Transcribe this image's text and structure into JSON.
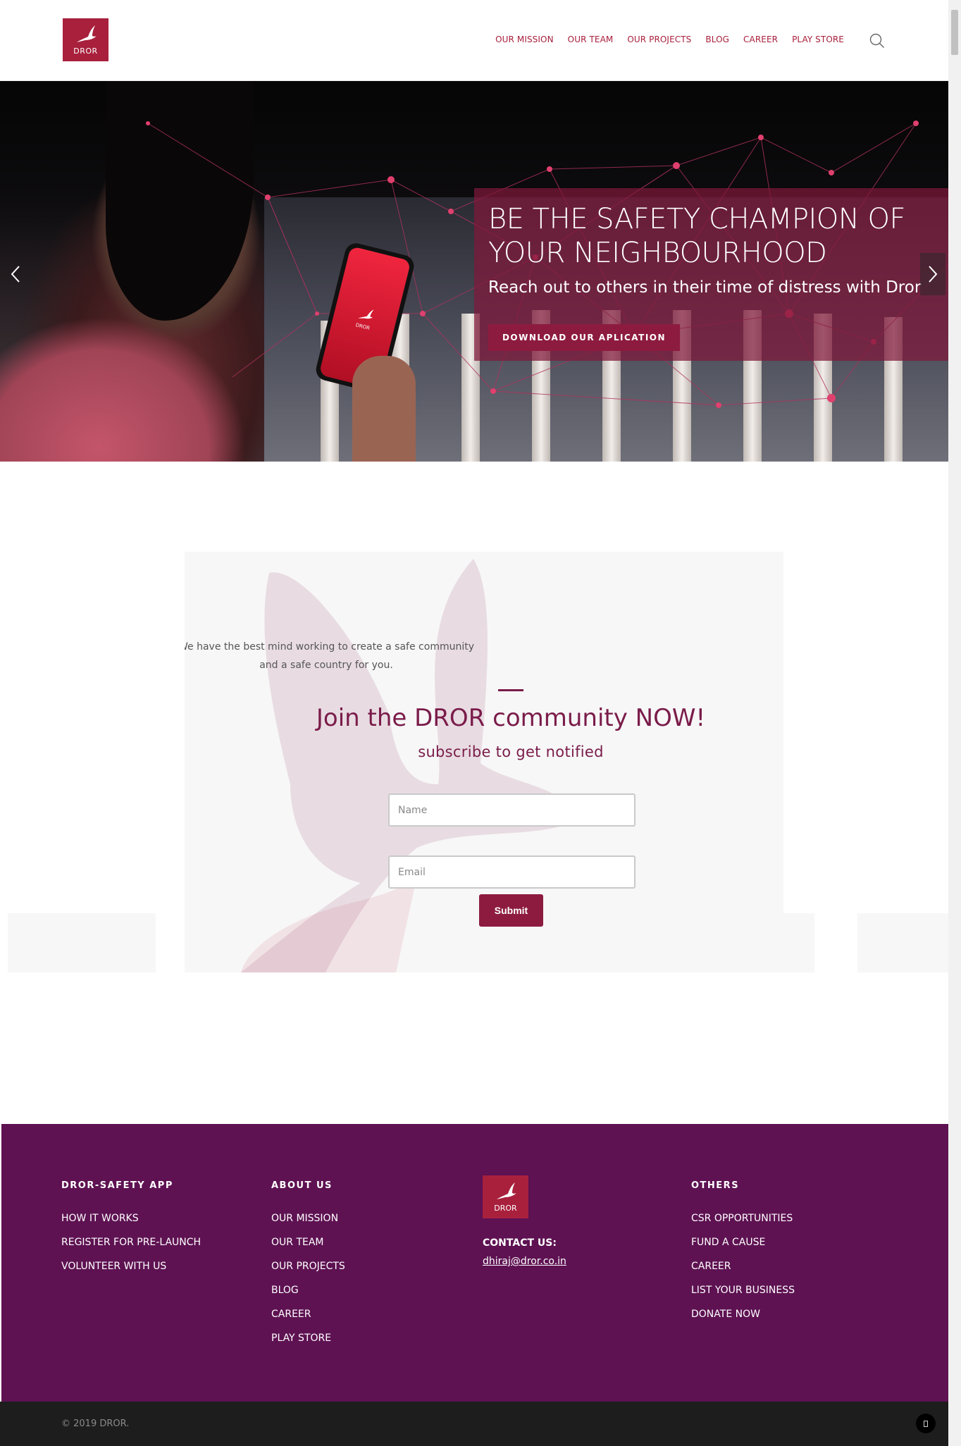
{
  "header": {
    "logo_text": "DROR",
    "nav": [
      "OUR MISSION",
      "OUR TEAM",
      "OUR PROJECTS",
      "BLOG",
      "CAREER",
      "PLAY STORE"
    ],
    "search_icon": "search-icon"
  },
  "hero": {
    "title": "BE THE SAFETY CHAMPION OF YOUR NEIGHBOURHOOD",
    "subtitle": "Reach out to others in their time of distress with Dror",
    "button": "DOWNLOAD OUR APLICATION",
    "phone_text": "DROR",
    "prev_icon": "chevron-left-icon",
    "next_icon": "chevron-right-icon"
  },
  "subscribe": {
    "intro_line1": "We have the best mind working to create a safe community",
    "intro_line2": "and a safe country for you.",
    "heading": "Join the DROR community NOW!",
    "subheading": "subscribe to get notified",
    "name_placeholder": "Name",
    "email_placeholder": "Email",
    "submit": "Submit"
  },
  "footer": {
    "col1": {
      "title": "DROR-SAFETY APP",
      "links": [
        "HOW IT WORKS",
        "REGISTER FOR PRE-LAUNCH",
        "VOLUNTEER WITH US"
      ]
    },
    "col2": {
      "title": "ABOUT US",
      "links": [
        "OUR MISSION",
        "OUR TEAM",
        "OUR PROJECTS",
        "BLOG",
        "CAREER",
        "PLAY STORE"
      ]
    },
    "col3": {
      "logo_text": "DROR",
      "contact_label": "CONTACT US:",
      "email": "dhiraj@dror.co.in"
    },
    "col4": {
      "title": "OTHERS",
      "links": [
        "CSR OPPORTUNITIES",
        "FUND A CAUSE",
        "CAREER",
        "LIST YOUR BUSINESS",
        "DONATE NOW"
      ]
    },
    "copyright": "© 2019 DROR."
  },
  "colors": {
    "brand": "#a8203c",
    "accent": "#8d1b40",
    "heading": "#7a1c4a",
    "footer_bg": "#5e1252",
    "bottom_bar": "#1d1d1d"
  }
}
